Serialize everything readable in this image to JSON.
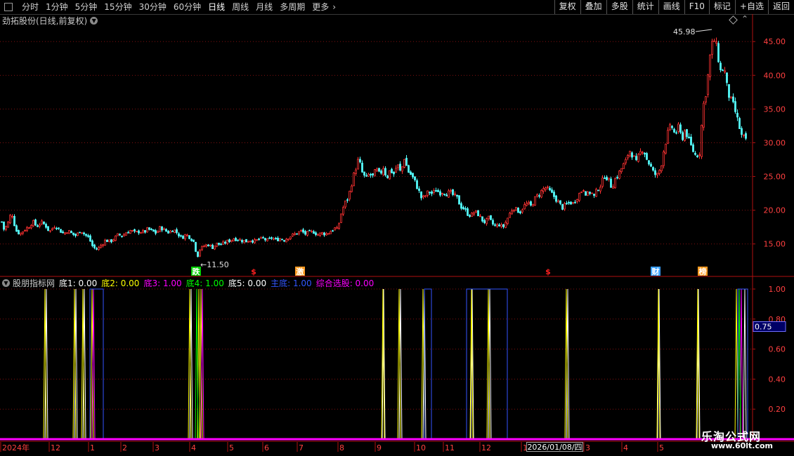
{
  "toolbar": {
    "periods": [
      "分时",
      "1分钟",
      "5分钟",
      "15分钟",
      "30分钟",
      "60分钟",
      "日线",
      "周线",
      "月线",
      "多周期",
      "更多"
    ],
    "active_period": "日线",
    "right_buttons": [
      "复权",
      "叠加",
      "多股",
      "统计",
      "画线",
      "F10",
      "标记",
      "+自选",
      "返回"
    ]
  },
  "stock": {
    "title": "劲拓股份(日线,前复权)"
  },
  "indicator": {
    "name": "股朋指标网",
    "items": [
      {
        "label": "底1: 0.00",
        "color": "#ffffff"
      },
      {
        "label": "底2: 0.00",
        "color": "#ffff00"
      },
      {
        "label": "底3: 1.00",
        "color": "#ff00ff"
      },
      {
        "label": "底4: 1.00",
        "color": "#00ff00"
      },
      {
        "label": "底5: 0.00",
        "color": "#ffffff"
      },
      {
        "label": "主底: 1.00",
        "color": "#3355ff"
      },
      {
        "label": "综合选股: 0.00",
        "color": "#ff00ff"
      }
    ]
  },
  "colors": {
    "up": "#ff3232",
    "down": "#54fcfc",
    "axis": "#b01010",
    "grid": "#801010"
  },
  "chart_data": [
    {
      "type": "candlestick",
      "title": "劲拓股份(日线,前复权)",
      "yticks": [
        15,
        20,
        25,
        30,
        35,
        40,
        45
      ],
      "ylim": [
        10.5,
        47.0
      ],
      "high_label": "45.98",
      "low_label": "11.50",
      "close_points": [
        [
          0,
          19.0
        ],
        [
          5,
          17.2
        ],
        [
          10,
          17.8
        ],
        [
          16,
          19.8
        ],
        [
          22,
          17.0
        ],
        [
          28,
          16.5
        ],
        [
          34,
          17.1
        ],
        [
          40,
          17.5
        ],
        [
          46,
          18.3
        ],
        [
          52,
          17.6
        ],
        [
          58,
          18.2
        ],
        [
          64,
          17.8
        ],
        [
          70,
          16.8
        ],
        [
          78,
          17.8
        ],
        [
          84,
          17.1
        ],
        [
          90,
          16.5
        ],
        [
          96,
          17.0
        ],
        [
          102,
          16.5
        ],
        [
          108,
          16.2
        ],
        [
          114,
          17.1
        ],
        [
          120,
          16.4
        ],
        [
          126,
          15.9
        ],
        [
          132,
          14.5
        ],
        [
          138,
          14.2
        ],
        [
          144,
          14.9
        ],
        [
          150,
          15.6
        ],
        [
          156,
          15.3
        ],
        [
          162,
          15.8
        ],
        [
          168,
          16.4
        ],
        [
          174,
          16.2
        ],
        [
          180,
          16.8
        ],
        [
          186,
          17.0
        ],
        [
          192,
          16.6
        ],
        [
          198,
          16.9
        ],
        [
          204,
          16.7
        ],
        [
          210,
          17.2
        ],
        [
          216,
          16.9
        ],
        [
          222,
          16.6
        ],
        [
          228,
          17.5
        ],
        [
          234,
          17.0
        ],
        [
          240,
          16.7
        ],
        [
          246,
          17.2
        ],
        [
          252,
          16.6
        ],
        [
          258,
          15.9
        ],
        [
          264,
          16.4
        ],
        [
          270,
          16.0
        ],
        [
          276,
          15.2
        ],
        [
          280,
          13.0
        ],
        [
          284,
          14.2
        ],
        [
          290,
          14.7
        ],
        [
          296,
          14.9
        ],
        [
          302,
          14.5
        ],
        [
          308,
          15.0
        ],
        [
          314,
          14.9
        ],
        [
          320,
          15.2
        ],
        [
          326,
          15.5
        ],
        [
          332,
          15.8
        ],
        [
          338,
          15.7
        ],
        [
          344,
          15.5
        ],
        [
          350,
          15.4
        ],
        [
          356,
          15.6
        ],
        [
          362,
          15.4
        ],
        [
          368,
          15.7
        ],
        [
          374,
          15.8
        ],
        [
          380,
          15.5
        ],
        [
          386,
          15.9
        ],
        [
          392,
          15.6
        ],
        [
          398,
          15.8
        ],
        [
          404,
          15.6
        ],
        [
          410,
          16.0
        ],
        [
          416,
          16.3
        ],
        [
          422,
          16.6
        ],
        [
          428,
          16.9
        ],
        [
          434,
          16.5
        ],
        [
          440,
          16.7
        ],
        [
          446,
          16.8
        ],
        [
          452,
          16.4
        ],
        [
          458,
          16.6
        ],
        [
          464,
          16.5
        ],
        [
          470,
          16.9
        ],
        [
          476,
          17.3
        ],
        [
          480,
          17.1
        ],
        [
          485,
          19.5
        ],
        [
          490,
          21.0
        ],
        [
          495,
          21.8
        ],
        [
          500,
          24.0
        ],
        [
          505,
          26.0
        ],
        [
          510,
          27.6
        ],
        [
          515,
          25.6
        ],
        [
          520,
          24.6
        ],
        [
          525,
          25.4
        ],
        [
          530,
          25.0
        ],
        [
          535,
          26.0
        ],
        [
          540,
          25.2
        ],
        [
          545,
          26.4
        ],
        [
          550,
          24.8
        ],
        [
          555,
          26.0
        ],
        [
          560,
          25.4
        ],
        [
          565,
          26.8
        ],
        [
          570,
          25.5
        ],
        [
          575,
          27.8
        ],
        [
          580,
          25.8
        ],
        [
          585,
          25.2
        ],
        [
          590,
          24.2
        ],
        [
          595,
          23.0
        ],
        [
          600,
          21.6
        ],
        [
          605,
          22.2
        ],
        [
          610,
          22.8
        ],
        [
          615,
          22.4
        ],
        [
          620,
          23.0
        ],
        [
          625,
          22.6
        ],
        [
          630,
          22.8
        ],
        [
          635,
          22.5
        ],
        [
          640,
          22.6
        ],
        [
          645,
          22.2
        ],
        [
          650,
          21.8
        ],
        [
          655,
          20.6
        ],
        [
          660,
          20.2
        ],
        [
          665,
          19.5
        ],
        [
          670,
          19.2
        ],
        [
          675,
          19.8
        ],
        [
          680,
          19.4
        ],
        [
          685,
          18.6
        ],
        [
          690,
          18.2
        ],
        [
          695,
          18.8
        ],
        [
          700,
          18.0
        ],
        [
          705,
          17.6
        ],
        [
          710,
          17.9
        ],
        [
          715,
          17.4
        ],
        [
          720,
          18.4
        ],
        [
          725,
          19.5
        ],
        [
          730,
          20.5
        ],
        [
          735,
          20.0
        ],
        [
          740,
          19.8
        ],
        [
          745,
          20.6
        ],
        [
          750,
          21.0
        ],
        [
          755,
          20.6
        ],
        [
          760,
          21.6
        ],
        [
          765,
          22.2
        ],
        [
          770,
          22.8
        ],
        [
          775,
          23.4
        ],
        [
          780,
          23.0
        ],
        [
          785,
          22.4
        ],
        [
          790,
          21.8
        ],
        [
          795,
          21.0
        ],
        [
          800,
          20.4
        ],
        [
          805,
          20.8
        ],
        [
          810,
          21.2
        ],
        [
          815,
          21.0
        ],
        [
          820,
          21.8
        ],
        [
          825,
          22.6
        ],
        [
          830,
          23.2
        ],
        [
          835,
          22.2
        ],
        [
          840,
          22.8
        ],
        [
          845,
          22.0
        ],
        [
          850,
          23.2
        ],
        [
          855,
          23.8
        ],
        [
          860,
          25.2
        ],
        [
          865,
          24.6
        ],
        [
          870,
          23.4
        ],
        [
          875,
          24.6
        ],
        [
          880,
          25.4
        ],
        [
          885,
          26.4
        ],
        [
          890,
          27.2
        ],
        [
          895,
          29.0
        ],
        [
          900,
          28.2
        ],
        [
          905,
          27.0
        ],
        [
          910,
          28.4
        ],
        [
          915,
          29.2
        ],
        [
          920,
          27.6
        ],
        [
          925,
          26.6
        ],
        [
          930,
          25.4
        ],
        [
          935,
          25.2
        ],
        [
          940,
          26.4
        ],
        [
          945,
          29.4
        ],
        [
          950,
          31.4
        ],
        [
          955,
          32.6
        ],
        [
          960,
          31.2
        ],
        [
          965,
          32.2
        ],
        [
          970,
          30.6
        ],
        [
          975,
          32.0
        ],
        [
          980,
          30.2
        ],
        [
          985,
          29.0
        ],
        [
          990,
          28.0
        ],
        [
          995,
          28.6
        ],
        [
          1000,
          35.2
        ],
        [
          1005,
          38.0
        ],
        [
          1010,
          42.8
        ],
        [
          1015,
          45.6
        ],
        [
          1020,
          43.8
        ],
        [
          1025,
          40.6
        ],
        [
          1030,
          41.2
        ],
        [
          1035,
          37.6
        ],
        [
          1040,
          36.2
        ],
        [
          1045,
          35.0
        ],
        [
          1050,
          33.0
        ],
        [
          1055,
          31.0
        ],
        [
          1060,
          30.6
        ],
        [
          1063,
          29.4
        ]
      ],
      "events": [
        "跌",
        "$",
        "激",
        "$",
        "财",
        "榜"
      ],
      "x_labels": [
        "2024年",
        "12",
        "1",
        "2",
        "3",
        "4",
        "5",
        "6",
        "7",
        "8",
        "9",
        "10",
        "11",
        "12",
        "1",
        "3",
        "4",
        "5"
      ],
      "crosshair_date": "2026/01/08/四"
    },
    {
      "type": "line",
      "title": "股朋指标网",
      "yticks": [
        "1.00",
        "0.80",
        "0.60",
        "0.40",
        "0.20"
      ],
      "ylim": [
        0,
        1
      ],
      "current_value": "0.75",
      "series": [
        {
          "name": "底1",
          "color": "#ffffff",
          "spikes": [
            66,
            108,
            120,
            272,
            546,
            570,
            604,
            672,
            697,
            808,
            938,
            994
          ]
        },
        {
          "name": "底2",
          "color": "#ffff00",
          "spikes": [
            64,
            106,
            118,
            131,
            270,
            283,
            286,
            545,
            568,
            602,
            671,
            695,
            806,
            937,
            993,
            1048
          ]
        },
        {
          "name": "底3",
          "color": "#ff00ff",
          "spikes": [
            133,
            288,
            1055
          ]
        },
        {
          "name": "底4",
          "color": "#00ff00",
          "spikes": [
            280,
            1052
          ]
        },
        {
          "name": "底5",
          "color": "#ffffff",
          "spikes": [
            1060
          ]
        },
        {
          "name": "主底",
          "color": "#3355ff",
          "pulses": [
            [
              128,
              147
            ],
            [
              604,
              614
            ],
            [
              664,
              722
            ],
            [
              1050,
              1064
            ]
          ]
        },
        {
          "name": "综合选股",
          "color": "#ff00ff",
          "spikes": []
        }
      ]
    }
  ],
  "watermark": {
    "text": "乐淘公式网",
    "url": "www.60lt.com"
  }
}
